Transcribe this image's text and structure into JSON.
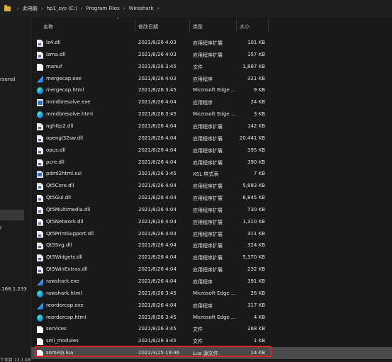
{
  "breadcrumb": {
    "items": [
      "此电脑",
      "hp1_sys (C:)",
      "Program Files",
      "Wireshark"
    ],
    "separator": "›"
  },
  "sidebar": {
    "fragments": [
      "rsonal",
      "I",
      ".168.1.233"
    ]
  },
  "columns": {
    "name": "名称",
    "date": "修改日期",
    "type": "类型",
    "size": "大小"
  },
  "files": [
    {
      "icon": "dll-file-icon",
      "name": "lz4.dll",
      "date": "2021/8/26 4:03",
      "type": "应用程序扩展",
      "size": "101 KB"
    },
    {
      "icon": "dll-file-icon",
      "name": "lzma.dll",
      "date": "2021/8/26 4:03",
      "type": "应用程序扩展",
      "size": "157 KB"
    },
    {
      "icon": "file-icon",
      "name": "manuf",
      "date": "2021/8/26 3:45",
      "type": "文件",
      "size": "1,887 KB"
    },
    {
      "icon": "wireshark-exe-icon",
      "name": "mergecap.exe",
      "date": "2021/8/26 4:03",
      "type": "应用程序",
      "size": "321 KB"
    },
    {
      "icon": "edge-html-icon",
      "name": "mergecap.html",
      "date": "2021/8/26 3:45",
      "type": "Microsoft Edge ...",
      "size": "9 KB"
    },
    {
      "icon": "console-exe-icon",
      "name": "mmdbresolve.exe",
      "date": "2021/8/26 4:04",
      "type": "应用程序",
      "size": "24 KB"
    },
    {
      "icon": "edge-html-icon",
      "name": "mmdbresolve.html",
      "date": "2021/8/26 3:45",
      "type": "Microsoft Edge ...",
      "size": "3 KB"
    },
    {
      "icon": "dll-file-icon",
      "name": "nghttp2.dll",
      "date": "2021/8/26 4:04",
      "type": "应用程序扩展",
      "size": "142 KB"
    },
    {
      "icon": "dll-file-icon",
      "name": "opengl32sw.dll",
      "date": "2021/8/26 4:04",
      "type": "应用程序扩展",
      "size": "20,441 KB"
    },
    {
      "icon": "dll-file-icon",
      "name": "opus.dll",
      "date": "2021/8/26 4:04",
      "type": "应用程序扩展",
      "size": "395 KB"
    },
    {
      "icon": "dll-file-icon",
      "name": "pcre.dll",
      "date": "2021/8/26 4:04",
      "type": "应用程序扩展",
      "size": "390 KB"
    },
    {
      "icon": "xsl-file-icon",
      "name": "pdml2html.xsl",
      "date": "2021/8/26 3:45",
      "type": "XSL 样式表",
      "size": "7 KB"
    },
    {
      "icon": "dll-file-icon",
      "name": "Qt5Core.dll",
      "date": "2021/8/26 4:04",
      "type": "应用程序扩展",
      "size": "5,883 KB"
    },
    {
      "icon": "dll-file-icon",
      "name": "Qt5Gui.dll",
      "date": "2021/8/26 4:04",
      "type": "应用程序扩展",
      "size": "6,845 KB"
    },
    {
      "icon": "dll-file-icon",
      "name": "Qt5Multimedia.dll",
      "date": "2021/8/26 4:04",
      "type": "应用程序扩展",
      "size": "730 KB"
    },
    {
      "icon": "dll-file-icon",
      "name": "Qt5Network.dll",
      "date": "2021/8/26 4:04",
      "type": "应用程序扩展",
      "size": "1,310 KB"
    },
    {
      "icon": "dll-file-icon",
      "name": "Qt5PrintSupport.dll",
      "date": "2021/8/26 4:04",
      "type": "应用程序扩展",
      "size": "311 KB"
    },
    {
      "icon": "dll-file-icon",
      "name": "Qt5Svg.dll",
      "date": "2021/8/26 4:04",
      "type": "应用程序扩展",
      "size": "324 KB"
    },
    {
      "icon": "dll-file-icon",
      "name": "Qt5Widgets.dll",
      "date": "2021/8/26 4:04",
      "type": "应用程序扩展",
      "size": "5,370 KB"
    },
    {
      "icon": "dll-file-icon",
      "name": "Qt5WinExtras.dll",
      "date": "2021/8/26 4:04",
      "type": "应用程序扩展",
      "size": "232 KB"
    },
    {
      "icon": "wireshark-exe-icon",
      "name": "rawshark.exe",
      "date": "2021/8/26 4:04",
      "type": "应用程序",
      "size": "391 KB"
    },
    {
      "icon": "edge-html-icon",
      "name": "rawshark.html",
      "date": "2021/8/26 3:45",
      "type": "Microsoft Edge ...",
      "size": "26 KB"
    },
    {
      "icon": "wireshark-exe-icon",
      "name": "reordercap.exe",
      "date": "2021/8/26 4:04",
      "type": "应用程序",
      "size": "317 KB"
    },
    {
      "icon": "edge-html-icon",
      "name": "reordercap.html",
      "date": "2021/8/26 3:45",
      "type": "Microsoft Edge ...",
      "size": "4 KB"
    },
    {
      "icon": "file-icon",
      "name": "services",
      "date": "2021/8/26 3:45",
      "type": "文件",
      "size": "268 KB"
    },
    {
      "icon": "file-icon",
      "name": "smi_modules",
      "date": "2021/8/26 3:45",
      "type": "文件",
      "size": "1 KB"
    },
    {
      "icon": "file-icon",
      "name": "someip.lua",
      "date": "2022/3/25 18:36",
      "type": "Lua 源文件",
      "size": "14 KB",
      "selected": true
    }
  ],
  "status": {
    "text": "个项目  13.1 KB"
  },
  "colors": {
    "background": "#191919",
    "selection": "#4a4a4a",
    "highlight_border": "#e32424",
    "folder": "#d9b13a"
  }
}
